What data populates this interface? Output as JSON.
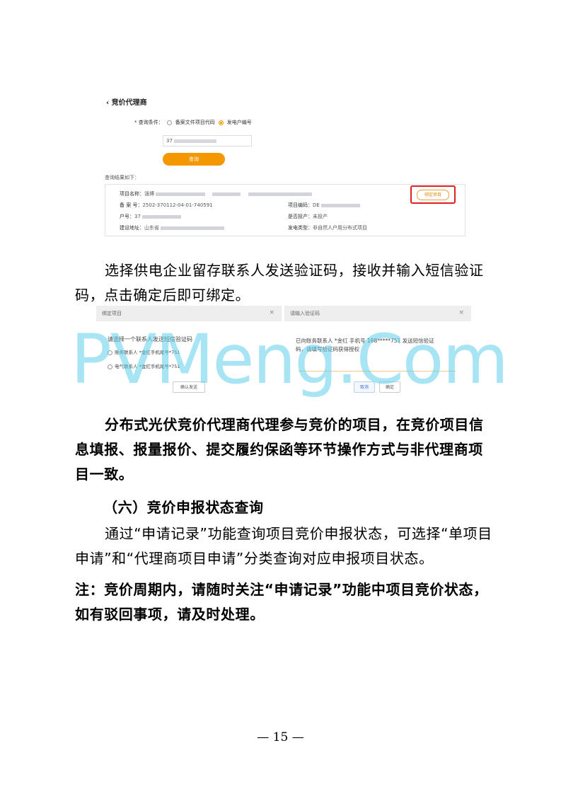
{
  "shot1": {
    "back_title": "‹ 竞价代理商",
    "query_label": "* 查询条件：",
    "option1": "备案文件项目代码",
    "option2": "发电户编号",
    "input_value": "37",
    "query_button": "查询",
    "result_label": "查询结果如下：",
    "rows": {
      "project_name_label": "项目名称：",
      "project_name_value": "淄博",
      "filing_label": "备 案 号：",
      "filing_value": "2502-370112-04-01-740591",
      "account_label": "户号：",
      "account_value": "37",
      "address_label": "建设地址：",
      "address_value": "山东省",
      "code_label": "项目编码：",
      "code_value": "DE",
      "operation_label": "是否投产：",
      "operation_value": "未投产",
      "gen_type_label": "发电类型：",
      "gen_type_value": "非自然人户用分布式项目"
    },
    "bind_button": "绑定项目"
  },
  "para1": "选择供电企业留存联系人发送验证码，接收并输入短信验证码，点击确定后即可绑定。",
  "dialog_left": {
    "title": "绑定项目",
    "close": "×",
    "prompt": "请选择一个联系人发送短信验证码",
    "option1": "账务联系人 *金红手机尾号*751",
    "option2": "电气联系人 *金红手机尾号*751",
    "confirm_send": "确认发送"
  },
  "dialog_right": {
    "title": "请输入验证码",
    "close": "×",
    "message_line1": "已向账务联系人 *金红 手机号 188*****751 发送短信验证",
    "message_line2": "码，请填写验证码获得授权",
    "cancel": "取消",
    "ok": "确定"
  },
  "watermark": "PVMeng.Com",
  "para2": "分布式光伏竞价代理商代理参与竞价的项目，在竞价项目信息填报、报量报价、提交履约保函等环节操作方式与非代理商项目一致。",
  "heading": "（六）竞价申报状态查询",
  "para3": "通过“申请记录”功能查询项目竞价申报状态，可选择“单项目申请”和“代理商项目申请”分类查询对应申报项目状态。",
  "para4": "注：竞价周期内，请随时关注“申请记录”功能中项目竞价状态，如有驳回事项，请及时处理。",
  "page_number": "— 15 —"
}
